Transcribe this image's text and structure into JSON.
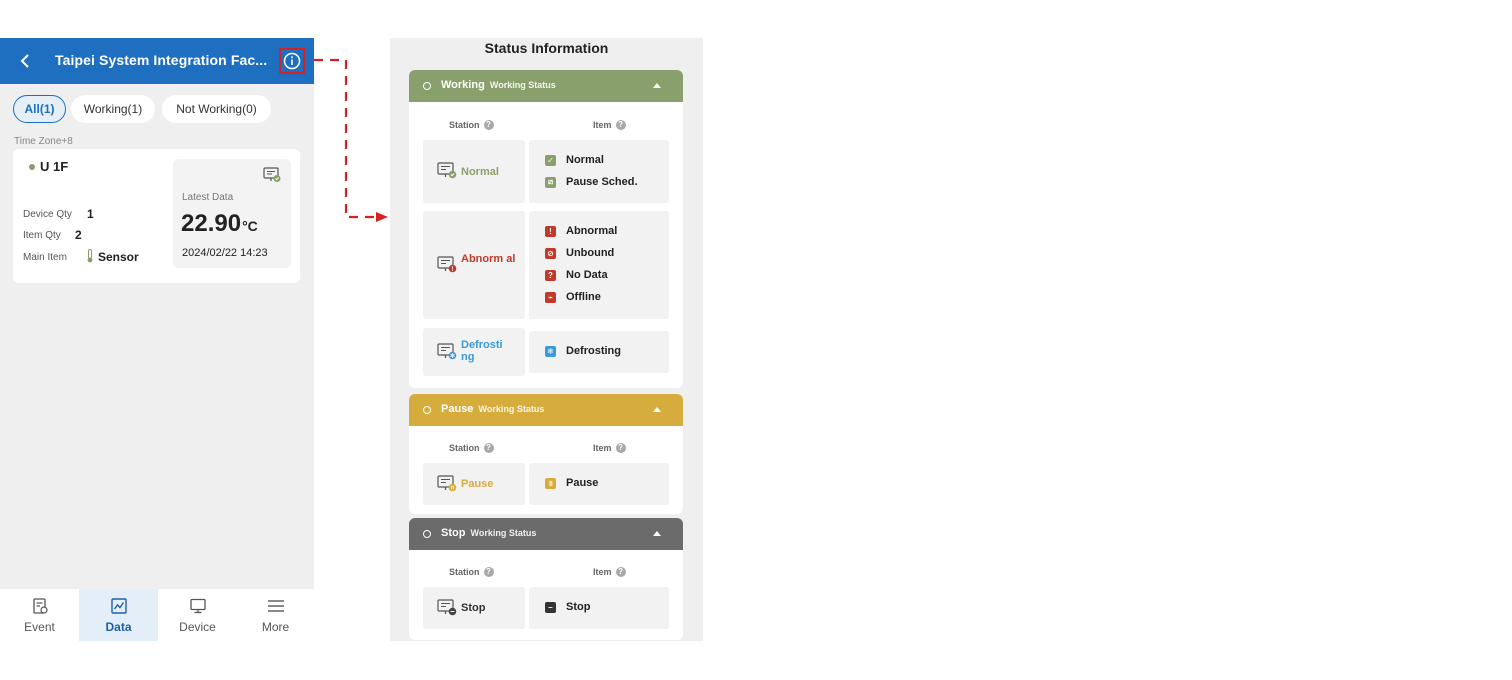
{
  "phone": {
    "title": "Taipei System Integration Fac...",
    "filters": {
      "all": "All(1)",
      "working": "Working(1)",
      "not_working": "Not Working(0)"
    },
    "timezone": "Time Zone+8",
    "card": {
      "location": "U 1F",
      "device_qty_label": "Device Qty",
      "device_qty": "1",
      "item_qty_label": "Item Qty",
      "item_qty": "2",
      "main_item_label": "Main Item",
      "main_item": "Sensor",
      "latest_label": "Latest Data",
      "latest_value": "22.90",
      "latest_unit": "°C",
      "latest_date": "2024/02/22 14:23"
    },
    "nav": {
      "event": "Event",
      "data": "Data",
      "device": "Device",
      "more": "More"
    }
  },
  "status": {
    "title": "Status Information",
    "station_label": "Station",
    "item_label": "Item",
    "working": {
      "name": "Working",
      "sub": "Working Status",
      "normal_station": "Normal",
      "normal_items": [
        "Normal",
        "Pause Sched."
      ],
      "abnormal_station": "Abnorm al",
      "abnormal_items": [
        "Abnormal",
        "Unbound",
        "No Data",
        "Offline"
      ],
      "defrost_station": "Defrosti ng",
      "defrost_item": "Defrosting"
    },
    "pause": {
      "name": "Pause",
      "sub": "Working Status",
      "station": "Pause",
      "item": "Pause"
    },
    "stop": {
      "name": "Stop",
      "sub": "Working Status",
      "station": "Stop",
      "item": "Stop"
    }
  },
  "colors": {
    "primary": "#1e6fbf",
    "working": "#8aa06c",
    "pause": "#d6ac3c",
    "stop": "#6b6b6b",
    "abnormal": "#c0392b",
    "defrost": "#3a9ad9",
    "highlight": "#d92020"
  }
}
